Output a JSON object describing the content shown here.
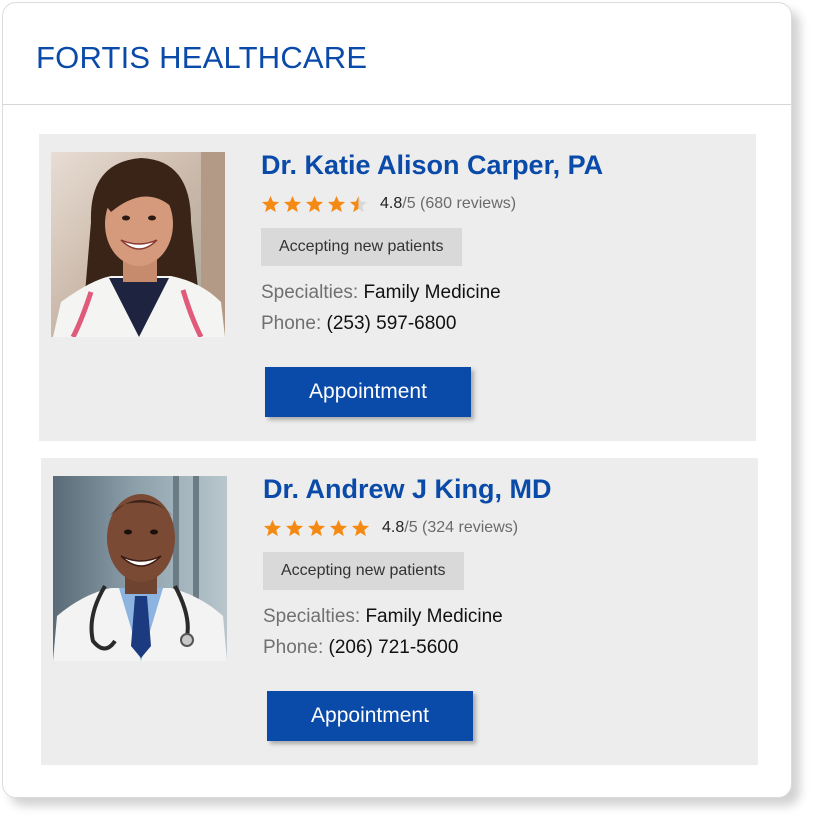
{
  "header": {
    "title": "FORTIS HEALTHCARE"
  },
  "colors": {
    "brand": "#0a4aa8",
    "star": "#f48a14",
    "card_bg": "#ededed",
    "badge_bg": "#d9d9d9"
  },
  "doctors": [
    {
      "name": "Dr. Katie Alison Carper, PA",
      "rating_stars": 4.5,
      "score": "4.8",
      "reviews": "/5 (680 reviews)",
      "status": "Accepting new patients",
      "specialties_label": "Specialties:",
      "specialties": "Family Medicine",
      "phone_label": "Phone:",
      "phone": "(253) 597-6800",
      "button": "Appointment"
    },
    {
      "name": "Dr. Andrew J King, MD",
      "rating_stars": 5,
      "score": "4.8",
      "reviews": "/5 (324 reviews)",
      "status": "Accepting new patients",
      "specialties_label": "Specialties:",
      "specialties": "Family Medicine",
      "phone_label": "Phone:",
      "phone": "(206) 721-5600",
      "button": "Appointment"
    }
  ]
}
